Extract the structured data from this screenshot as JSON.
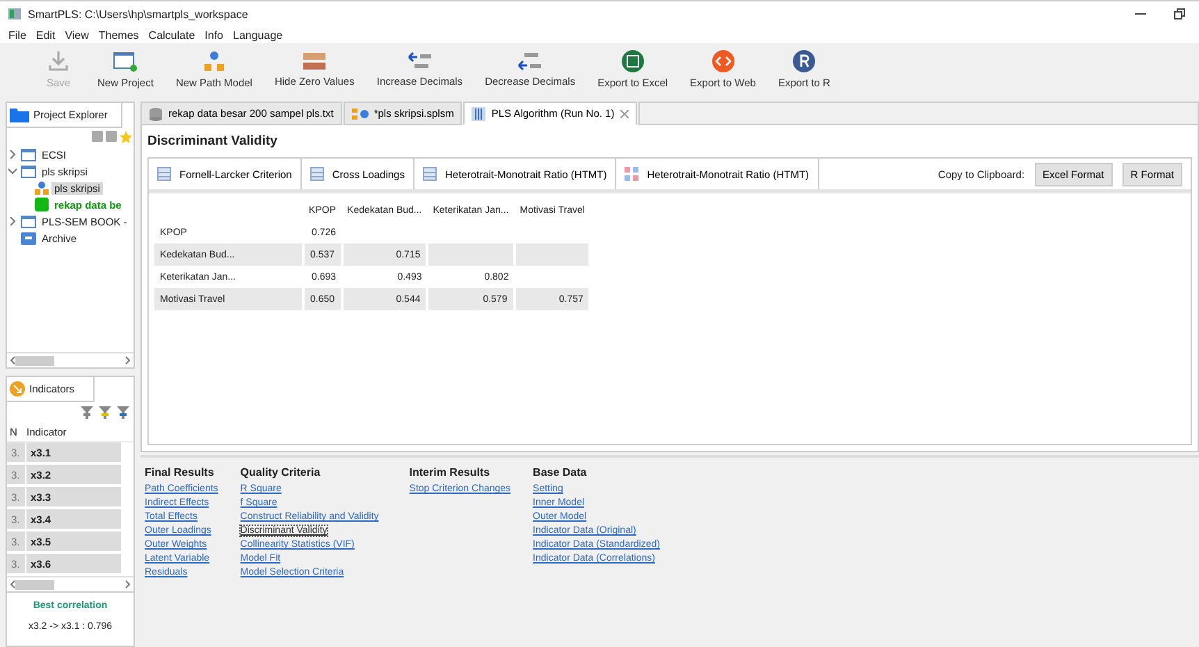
{
  "window": {
    "title": "SmartPLS: C:\\Users\\hp\\smartpls_workspace"
  },
  "menu": [
    "File",
    "Edit",
    "View",
    "Themes",
    "Calculate",
    "Info",
    "Language"
  ],
  "toolbar": [
    {
      "label": "Save",
      "kind": "save",
      "disabled": true
    },
    {
      "label": "New Project",
      "kind": "project",
      "disabled": false
    },
    {
      "label": "New Path Model",
      "kind": "model",
      "disabled": false
    },
    {
      "label": "Hide Zero Values",
      "kind": "zero",
      "disabled": false
    },
    {
      "label": "Increase Decimals",
      "kind": "inc",
      "disabled": false
    },
    {
      "label": "Decrease Decimals",
      "kind": "dec",
      "disabled": false
    },
    {
      "label": "Export to Excel",
      "kind": "excel",
      "disabled": false
    },
    {
      "label": "Export to Web",
      "kind": "web",
      "disabled": false
    },
    {
      "label": "Export to R",
      "kind": "r",
      "disabled": false
    }
  ],
  "explorer": {
    "title": "Project Explorer",
    "items": [
      {
        "label": "ECSI",
        "kind": "project",
        "expanded": false,
        "selected": false
      },
      {
        "label": "pls skripsi",
        "kind": "project",
        "expanded": true,
        "selected": false,
        "children": [
          {
            "label": "pls skripsi",
            "kind": "model",
            "selected": true
          },
          {
            "label": "rekap data be",
            "kind": "data",
            "selected": false
          }
        ]
      },
      {
        "label": "PLS-SEM BOOK -",
        "kind": "project",
        "expanded": false,
        "selected": false
      },
      {
        "label": "Archive",
        "kind": "archive",
        "selected": false
      }
    ]
  },
  "indicators": {
    "title": "Indicators",
    "columns": [
      "N",
      "Indicator"
    ],
    "rows": [
      {
        "n": "3.",
        "name": "x3.1"
      },
      {
        "n": "3.",
        "name": "x3.2"
      },
      {
        "n": "3.",
        "name": "x3.3"
      },
      {
        "n": "3.",
        "name": "x3.4"
      },
      {
        "n": "3.",
        "name": "x3.5"
      },
      {
        "n": "3.",
        "name": "x3.6"
      }
    ],
    "best_label": "Best correlation",
    "best_value": "x3.2 -> x3.1 : 0.796"
  },
  "editor_tabs": [
    {
      "label": "rekap data besar 200 sampel pls.txt",
      "kind": "data",
      "selected": false
    },
    {
      "label": "*pls skripsi.splsm",
      "kind": "model",
      "selected": false
    },
    {
      "label": "PLS Algorithm (Run No. 1)",
      "kind": "report",
      "selected": true
    }
  ],
  "result": {
    "title": "Discriminant Validity",
    "subtabs": [
      {
        "label": "Fornell-Larcker Criterion",
        "kind": "table"
      },
      {
        "label": "Cross Loadings",
        "kind": "table"
      },
      {
        "label": "Heterotrait-Monotrait Ratio (HTMT)",
        "kind": "table"
      },
      {
        "label": "Heterotrait-Monotrait Ratio (HTMT)",
        "kind": "chart"
      }
    ],
    "copy_label": "Copy to Clipboard:",
    "buttons": [
      "Excel Format",
      "R Format"
    ],
    "columns": [
      "KPOP",
      "Kedekatan Bud...",
      "Keterikatan Jan...",
      "Motivasi Travel"
    ],
    "rows": [
      {
        "label": "KPOP",
        "cells": [
          "0.726",
          null,
          null,
          null
        ]
      },
      {
        "label": "Kedekatan Bud...",
        "cells": [
          "0.537",
          "0.715",
          null,
          null
        ]
      },
      {
        "label": "Keterikatan Jan...",
        "cells": [
          "0.693",
          "0.493",
          "0.802",
          null
        ]
      },
      {
        "label": "Motivasi Travel",
        "cells": [
          "0.650",
          "0.544",
          "0.579",
          "0.757"
        ]
      }
    ]
  },
  "links": [
    {
      "heading": "Final Results",
      "items": [
        {
          "label": "Path Coefficients",
          "focused": false
        },
        {
          "label": "Indirect Effects",
          "focused": false
        },
        {
          "label": "Total Effects",
          "focused": false
        },
        {
          "label": "Outer Loadings",
          "focused": false
        },
        {
          "label": "Outer Weights",
          "focused": false
        },
        {
          "label": "Latent Variable",
          "focused": false
        },
        {
          "label": "Residuals",
          "focused": false
        }
      ]
    },
    {
      "heading": "Quality Criteria",
      "items": [
        {
          "label": "R Square",
          "focused": false
        },
        {
          "label": "f Square",
          "focused": false
        },
        {
          "label": "Construct Reliability and Validity",
          "focused": false
        },
        {
          "label": "Discriminant Validity",
          "focused": true
        },
        {
          "label": "Collinearity Statistics (VIF)",
          "focused": false
        },
        {
          "label": "Model Fit",
          "focused": false
        },
        {
          "label": "Model Selection Criteria",
          "focused": false
        }
      ]
    },
    {
      "heading": "Interim Results",
      "items": [
        {
          "label": "Stop Criterion Changes",
          "focused": false
        }
      ]
    },
    {
      "heading": "Base Data",
      "items": [
        {
          "label": "Setting",
          "focused": false
        },
        {
          "label": "Inner Model",
          "focused": false
        },
        {
          "label": "Outer Model",
          "focused": false
        },
        {
          "label": "Indicator Data (Original)",
          "focused": false
        },
        {
          "label": "Indicator Data (Standardized)",
          "focused": false
        },
        {
          "label": "Indicator Data (Correlations)",
          "focused": false
        }
      ]
    }
  ]
}
